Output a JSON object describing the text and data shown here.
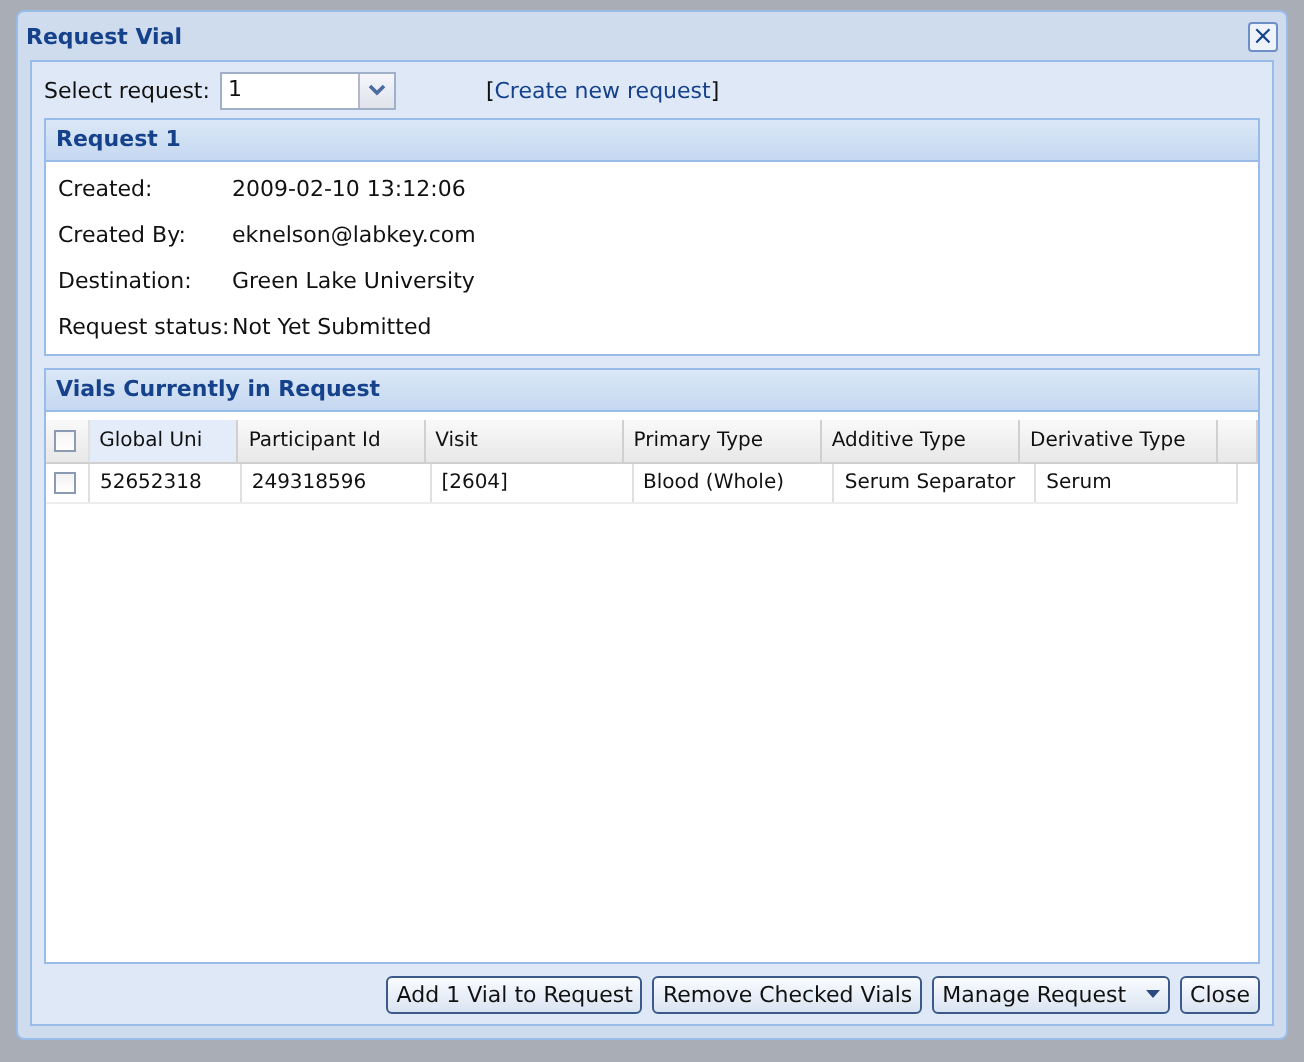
{
  "window": {
    "title": "Request Vial",
    "close_glyph": "×"
  },
  "select_request": {
    "label": "Select request:",
    "value": "1",
    "link_open": "[",
    "link": "Create new request",
    "link_close": "]"
  },
  "request_panel": {
    "title": "Request 1",
    "fields": [
      {
        "label": "Created:",
        "value": "2009-02-10 13:12:06"
      },
      {
        "label": "Created By:",
        "value": "eknelson@labkey.com"
      },
      {
        "label": "Destination:",
        "value": "Green Lake University"
      },
      {
        "label": "Request status:",
        "value": "Not Yet Submitted"
      }
    ]
  },
  "vials_panel": {
    "title": "Vials Currently in Request",
    "header_checked": false,
    "columns": [
      "Global Uni",
      "Participant Id",
      "Visit",
      "Primary Type",
      "Additive Type",
      "Derivative Type"
    ],
    "rows": [
      {
        "checked": false,
        "cells": [
          "52652318",
          "249318596",
          "[2604]",
          "Blood (Whole)",
          "Serum Separator",
          "Serum"
        ]
      }
    ]
  },
  "buttons": [
    {
      "label": "Add 1 Vial to Request",
      "kind": "plain"
    },
    {
      "label": "Remove Checked Vials",
      "kind": "plain"
    },
    {
      "label": "Manage Request",
      "kind": "menu"
    },
    {
      "label": "Close",
      "kind": "plain"
    }
  ]
}
